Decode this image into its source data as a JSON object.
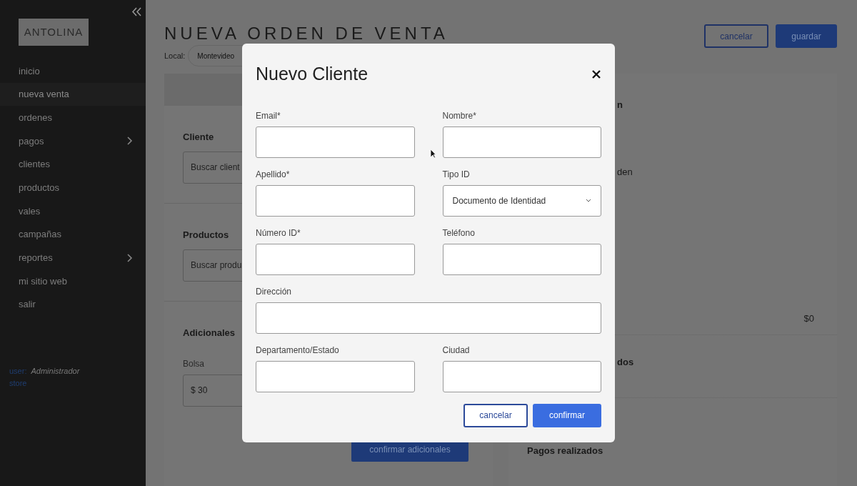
{
  "sidebar": {
    "logo": "ANTOLINA",
    "items": [
      {
        "label": "inicio",
        "selected": false,
        "has_submenu": false
      },
      {
        "label": "nueva venta",
        "selected": true,
        "has_submenu": false
      },
      {
        "label": "ordenes",
        "selected": false,
        "has_submenu": false
      },
      {
        "label": "pagos",
        "selected": false,
        "has_submenu": true
      },
      {
        "label": "clientes",
        "selected": false,
        "has_submenu": false
      },
      {
        "label": "productos",
        "selected": false,
        "has_submenu": false
      },
      {
        "label": "vales",
        "selected": false,
        "has_submenu": false
      },
      {
        "label": "campañas",
        "selected": false,
        "has_submenu": false
      },
      {
        "label": "reportes",
        "selected": false,
        "has_submenu": true
      },
      {
        "label": "mi sitio web",
        "selected": false,
        "has_submenu": false
      },
      {
        "label": "salir",
        "selected": false,
        "has_submenu": false
      }
    ],
    "user_label": "user:",
    "user_name": "Administrador",
    "store_label": "store"
  },
  "header": {
    "title": "NUEVA ORDEN DE VENTA",
    "cancel": "cancelar",
    "save": "guardar"
  },
  "local": {
    "label": "Local:",
    "value": "Montevideo"
  },
  "order": {
    "sections": [
      {
        "title": "Cliente",
        "placeholder": "Buscar client"
      },
      {
        "title": "Productos",
        "placeholder": "Buscar produ"
      },
      {
        "title": "Adicionales",
        "field_label": "Bolsa",
        "value": "$ 30"
      }
    ],
    "confirm_button": "confirmar adicionales"
  },
  "summary": {
    "fragments": [
      "n",
      "den"
    ],
    "total": "$0",
    "fragment_3": "dos",
    "payments_title": "Pagos realizados"
  },
  "modal": {
    "title": "Nuevo Cliente",
    "fields": [
      {
        "label": "Email*",
        "kind": "text",
        "wide": false
      },
      {
        "label": "Nombre*",
        "kind": "text",
        "wide": false
      },
      {
        "label": "Apellido*",
        "kind": "text",
        "wide": false
      },
      {
        "label": "Tipo ID",
        "kind": "select",
        "wide": false,
        "value": "Documento de Identidad"
      },
      {
        "label": "Número ID*",
        "kind": "text",
        "wide": false
      },
      {
        "label": "Teléfono",
        "kind": "text",
        "wide": false
      },
      {
        "label": "Dirección",
        "kind": "text",
        "wide": true
      },
      {
        "label": "Departamento/Estado",
        "kind": "text",
        "wide": false
      },
      {
        "label": "Ciudad",
        "kind": "text",
        "wide": false
      }
    ],
    "cancel": "cancelar",
    "confirm": "confirmar"
  }
}
